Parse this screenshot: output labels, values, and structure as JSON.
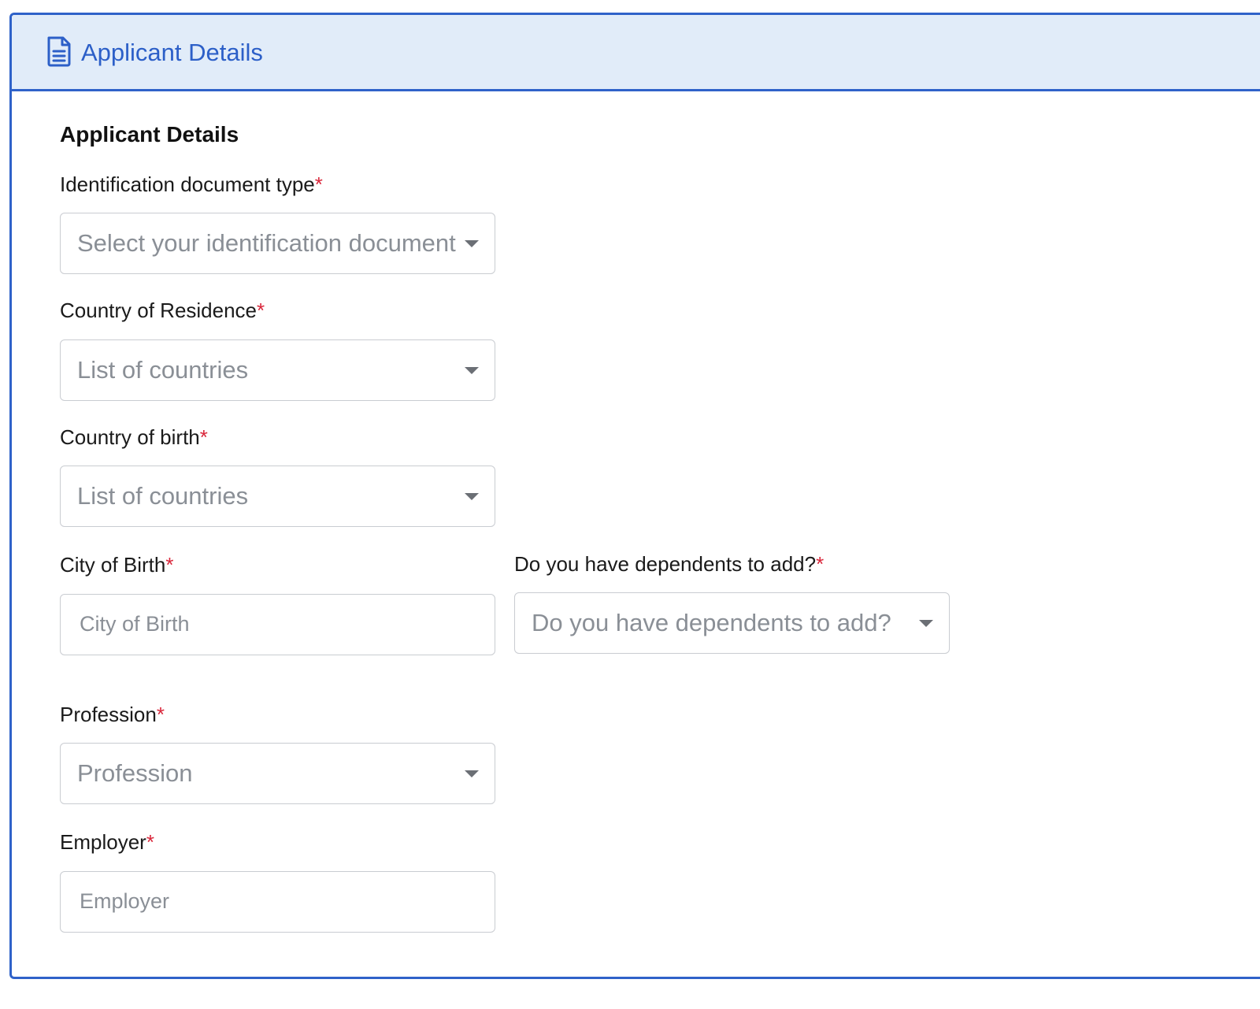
{
  "header": {
    "title": "Applicant Details",
    "icon": "document-icon",
    "accent_color": "#2f62c9",
    "background_color": "#e1ecf9"
  },
  "section": {
    "title": "Applicant Details"
  },
  "required_marker": "*",
  "required_color": "#d9263a",
  "fields": {
    "id_doc_type": {
      "label": "Identification document type",
      "type": "select",
      "placeholder": "Select your identification document type"
    },
    "country_residence": {
      "label": "Country of Residence",
      "type": "select",
      "placeholder": "List of countries"
    },
    "country_birth": {
      "label": "Country of birth",
      "type": "select",
      "placeholder": "List of countries"
    },
    "city_birth": {
      "label": "City of Birth",
      "type": "text",
      "placeholder": "City of Birth"
    },
    "dependents": {
      "label": "Do you have dependents to add?",
      "type": "select",
      "placeholder": "Do you have dependents to add?"
    },
    "profession": {
      "label": "Profession",
      "type": "select",
      "placeholder": "Profession"
    },
    "employer": {
      "label": "Employer",
      "type": "text",
      "placeholder": "Employer"
    }
  }
}
